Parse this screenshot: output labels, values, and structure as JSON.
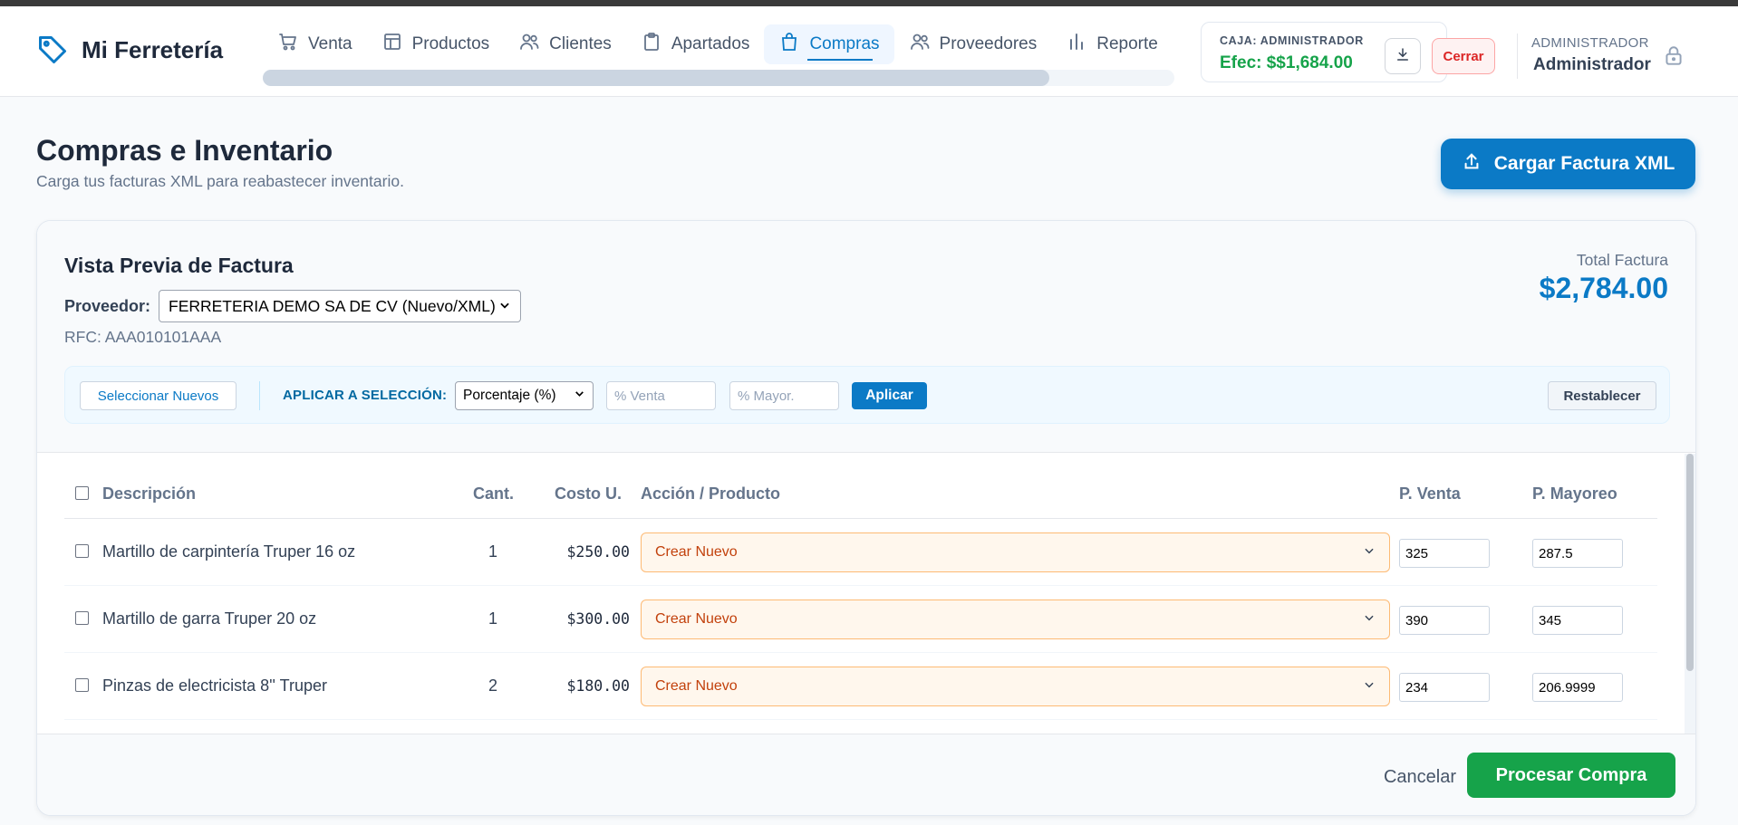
{
  "brand": {
    "title": "Mi Ferretería"
  },
  "nav": {
    "items": [
      {
        "label": "Venta",
        "icon": "cart-icon"
      },
      {
        "label": "Productos",
        "icon": "layout-icon"
      },
      {
        "label": "Clientes",
        "icon": "users-icon"
      },
      {
        "label": "Apartados",
        "icon": "clipboard-icon"
      },
      {
        "label": "Compras",
        "icon": "shopping-bag-icon",
        "active": true
      },
      {
        "label": "Proveedores",
        "icon": "users-icon"
      },
      {
        "label": "Reporte",
        "icon": "bar-chart-icon"
      }
    ]
  },
  "caja": {
    "label": "CAJA: ADMINISTRADOR",
    "amount": "Efec: $$1,684.00",
    "close_label": "Cerrar"
  },
  "user": {
    "role": "ADMINISTRADOR",
    "name": "Administrador"
  },
  "page": {
    "title": "Compras e Inventario",
    "subtitle": "Carga tus facturas XML para reabastecer inventario.",
    "upload_label": "Cargar Factura XML"
  },
  "invoice": {
    "title": "Vista Previa de Factura",
    "provider_label": "Proveedor:",
    "provider_value": "FERRETERIA DEMO SA DE CV (Nuevo/XML)",
    "rfc": "RFC: AAA010101AAA",
    "total_label": "Total Factura",
    "total_value": "$2,784.00"
  },
  "toolbar": {
    "select_new_label": "Seleccionar Nuevos",
    "apply_label": "APLICAR A SELECCIÓN:",
    "mode_value": "Porcentaje (%)",
    "venta_placeholder": "% Venta",
    "mayor_placeholder": "% Mayor.",
    "apply_button": "Aplicar",
    "reset_button": "Restablecer"
  },
  "table": {
    "headers": {
      "desc": "Descripción",
      "qty": "Cant.",
      "cost": "Costo U.",
      "action": "Acción / Producto",
      "pventa": "P. Venta",
      "pmayoreo": "P. Mayoreo"
    },
    "rows": [
      {
        "desc": "Martillo de carpintería Truper 16 oz",
        "qty": "1",
        "cost": "$250.00",
        "action": "Crear Nuevo",
        "pventa": "325",
        "pmayoreo": "287.5"
      },
      {
        "desc": "Martillo de garra Truper 20 oz",
        "qty": "1",
        "cost": "$300.00",
        "action": "Crear Nuevo",
        "pventa": "390",
        "pmayoreo": "345"
      },
      {
        "desc": "Pinzas de electricista 8'' Truper",
        "qty": "2",
        "cost": "$180.00",
        "action": "Crear Nuevo",
        "pventa": "234",
        "pmayoreo": "206.9999"
      }
    ]
  },
  "footer": {
    "cancel_label": "Cancelar",
    "process_label": "Procesar Compra"
  },
  "colors": {
    "accent": "#0b7ac6",
    "success": "#16a34a",
    "danger": "#dc2626"
  }
}
